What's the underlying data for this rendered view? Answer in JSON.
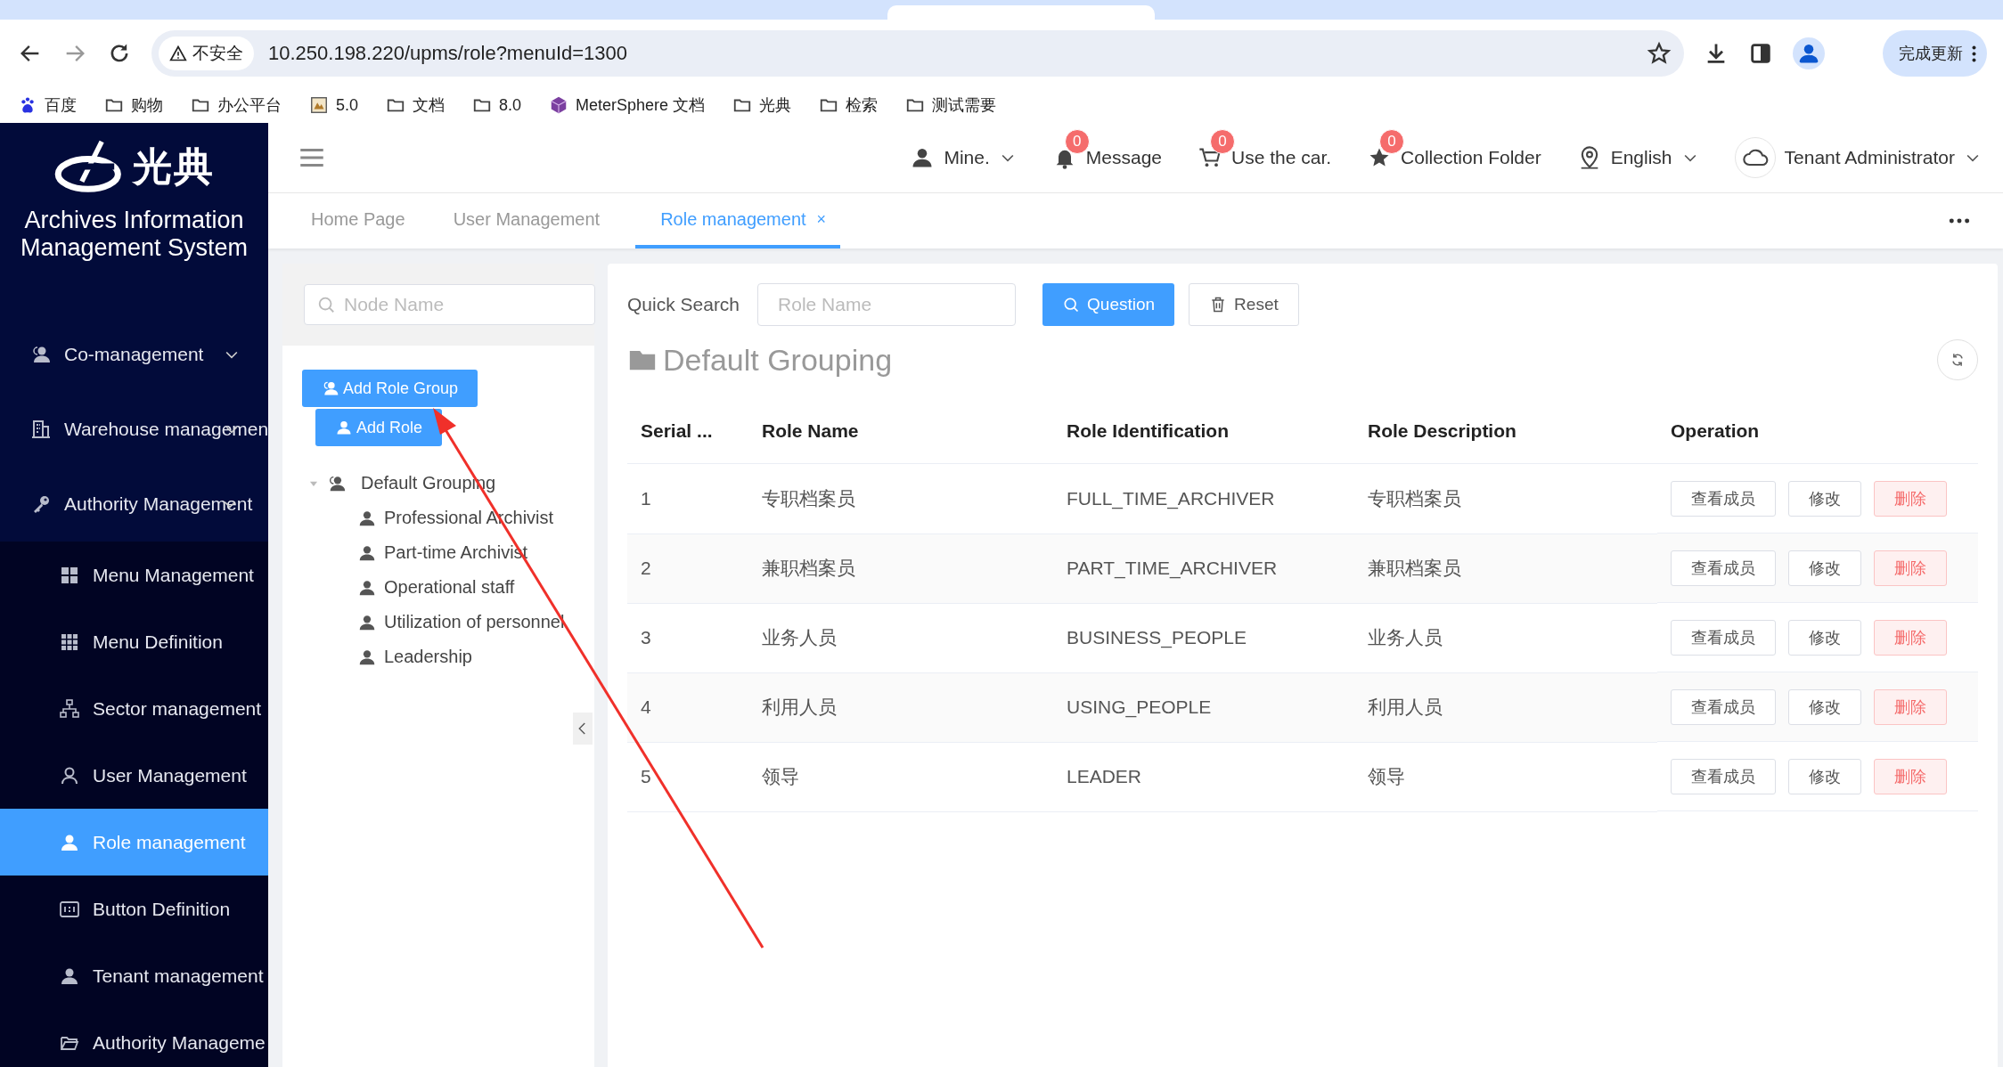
{
  "browser": {
    "security": "不安全",
    "url": "10.250.198.220/upms/role?menuId=1300",
    "update_button": "完成更新",
    "bookmarks": [
      "百度",
      "购物",
      "办公平台",
      "5.0",
      "文档",
      "8.0",
      "MeterSphere 文档",
      "光典",
      "检索",
      "测试需要"
    ]
  },
  "sidebar": {
    "logo_text": "光典",
    "title": "Archives Information Management System",
    "menu": [
      {
        "label": "Co-management",
        "expanded": false
      },
      {
        "label": "Warehouse managemen",
        "expanded": false
      },
      {
        "label": "Authority Management",
        "expanded": true,
        "children": [
          {
            "label": "Menu Management",
            "selected": false
          },
          {
            "label": "Menu Definition",
            "selected": false
          },
          {
            "label": "Sector management",
            "selected": false
          },
          {
            "label": "User Management",
            "selected": false
          },
          {
            "label": "Role management",
            "selected": true
          },
          {
            "label": "Button Definition",
            "selected": false
          },
          {
            "label": "Tenant management",
            "selected": false
          },
          {
            "label": "Authority Manageme",
            "selected": false
          }
        ]
      }
    ]
  },
  "header": {
    "items": [
      {
        "label": "Mine.",
        "dropdown": true
      },
      {
        "label": "Message",
        "badge": "0",
        "dropdown": false
      },
      {
        "label": "Use the car.",
        "badge": "0",
        "dropdown": false
      },
      {
        "label": "Collection Folder",
        "badge": "0",
        "dropdown": false
      },
      {
        "label": "English",
        "dropdown": true
      },
      {
        "label": "Tenant Administrator",
        "dropdown": true
      }
    ]
  },
  "tabs": [
    {
      "label": "Home Page",
      "selected": false
    },
    {
      "label": "User Management",
      "selected": false
    },
    {
      "label": "Role management",
      "selected": true,
      "close": "×"
    }
  ],
  "tree_panel": {
    "search": {
      "placeholder": "Node Name"
    },
    "buttons": [
      "Add Role Group",
      "Add Role"
    ],
    "tree": [
      {
        "label": "Default Grouping",
        "expanded": true,
        "children": [
          {
            "label": "Professional Archivist"
          },
          {
            "label": "Part-time Archivist"
          },
          {
            "label": "Operational staff"
          },
          {
            "label": "Utilization of personnel"
          },
          {
            "label": "Leadership"
          }
        ]
      }
    ]
  },
  "role_panel": {
    "quick_search": {
      "label": "Quick Search",
      "placeholder": "Role Name"
    },
    "search_button": "Question",
    "reset_button": "Reset",
    "group_title": "Default Grouping",
    "table": {
      "columns": [
        "Serial ...",
        "Role Name",
        "Role Identification",
        "Role Description",
        "Operation"
      ],
      "rows": [
        {
          "cells": [
            "1",
            "专职档案员",
            "FULL_TIME_ARCHIVER",
            "专职档案员"
          ],
          "operations": [
            {
              "label": "查看成员",
              "kind": "default"
            },
            {
              "label": "修改",
              "kind": "default"
            },
            {
              "label": "删除",
              "kind": "danger"
            }
          ]
        },
        {
          "cells": [
            "2",
            "兼职档案员",
            "PART_TIME_ARCHIVER",
            "兼职档案员"
          ],
          "operations": [
            {
              "label": "查看成员",
              "kind": "default"
            },
            {
              "label": "修改",
              "kind": "default"
            },
            {
              "label": "删除",
              "kind": "danger"
            }
          ]
        },
        {
          "cells": [
            "3",
            "业务人员",
            "BUSINESS_PEOPLE",
            "业务人员"
          ],
          "operations": [
            {
              "label": "查看成员",
              "kind": "default"
            },
            {
              "label": "修改",
              "kind": "default"
            },
            {
              "label": "删除",
              "kind": "danger"
            }
          ]
        },
        {
          "cells": [
            "4",
            "利用人员",
            "USING_PEOPLE",
            "利用人员"
          ],
          "operations": [
            {
              "label": "查看成员",
              "kind": "default"
            },
            {
              "label": "修改",
              "kind": "default"
            },
            {
              "label": "删除",
              "kind": "danger"
            }
          ]
        },
        {
          "cells": [
            "5",
            "领导",
            "LEADER",
            "领导"
          ],
          "operations": [
            {
              "label": "查看成员",
              "kind": "default"
            },
            {
              "label": "修改",
              "kind": "default"
            },
            {
              "label": "删除",
              "kind": "danger"
            }
          ]
        }
      ]
    }
  }
}
